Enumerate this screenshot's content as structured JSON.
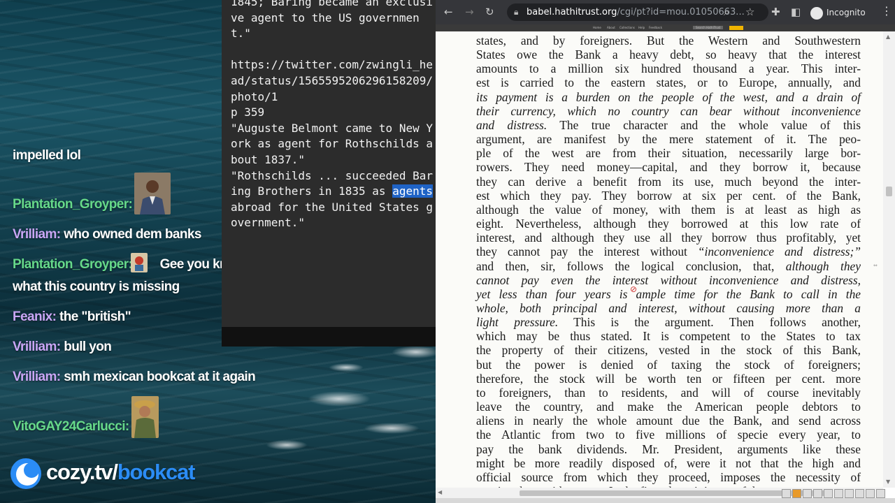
{
  "chat": {
    "messages": [
      {
        "user": "",
        "user_color": "#ffffff",
        "text": "impelled lol"
      },
      {
        "user": "Plantation_Groyper:",
        "user_color": "#66d98a",
        "text": "",
        "avatar": "man-in-suit-avatar"
      },
      {
        "user": "Vrilliam:",
        "user_color": "#c9a6f5",
        "text": "who owned dem banks"
      },
      {
        "user": "Plantation_Groyper:",
        "user_color": "#66d98a",
        "text": "Gee you know",
        "avatar": "cartoon-emote-avatar",
        "text2": "what this country is missing"
      },
      {
        "user": "Feanix:",
        "user_color": "#c9a6f5",
        "text": "the \"british\""
      },
      {
        "user": "Vrilliam:",
        "user_color": "#c9a6f5",
        "text": "bull yon"
      },
      {
        "user": "Vrilliam:",
        "user_color": "#c9a6f5",
        "text": "smh mexican bookcat at it again"
      },
      {
        "user": "VitoGAY24Carlucci:",
        "user_color": "#66d98a",
        "text": "",
        "avatar": "painted-portrait-avatar"
      }
    ]
  },
  "notes": {
    "line_top": "1845; Baring became an exclusive agent to the US government.\"",
    "blank": "",
    "link": "https://twitter.com/zwingli_head/status/1565595206296158209/photo/1",
    "page_ref": "p 359",
    "quote1": "\"Auguste Belmont came to New York as agent for Rothschilds about 1837.\"",
    "quote2_before": "\"Rothschilds ... succeeded Baring Brothers in 1835 as ",
    "quote2_highlight": "agents",
    "quote2_after": " abroad for the United States government.\""
  },
  "browser": {
    "url_host": "babel.hathitrust.org",
    "url_path": "/cgi/pt?id=mou.01050663...",
    "profile_label": "Incognito",
    "hathi_menu": [
      "Home",
      "About",
      "Collections",
      "Help",
      "Feedback"
    ],
    "hathi_search": "Search HathiTrust",
    "page_lines": [
      "states, and by foreigners. But the Western and Southwestern",
      "States owe the Bank a heavy debt, so heavy that the interest",
      "amounts to a million six hundred thousand a year. This inter-",
      "est is carried to the eastern states, or to Europe, annually, and",
      "its payment is a burden on the people of the west, and a drain of",
      "their currency, which no country can bear without inconvenience",
      "and distress. The true character and the whole value of this",
      "argument, are manifest by the mere statement of it. The peo-",
      "ple of the west are from their situation, necessarily large bor-",
      "rowers. They need money—capital, and they borrow it, because",
      "they can derive a benefit from its use, much beyond the inter-",
      "est which they pay. They borrow at six per cent. of the Bank,",
      "although the value of money, with them is at least as high as",
      "eight. Nevertheless, although they borrowed at this low rate of",
      "interest, and although they use all they borrow thus profitably, yet",
      "they cannot pay the interest without “inconvenience and distress;”",
      "and then, sir, follows the logical conclusion, that, although they",
      "cannot pay even the interest without inconvenience and distress,",
      "yet less than four years is ample time for the Bank to call in the",
      "whole, both principal and interest, without causing more than a",
      "light pressure. This is the argument. Then follows another,",
      "which may be thus stated. It is competent to the States to tax",
      "the property of their citizens, vested in the stock of this Bank,",
      "but the power is denied of taxing the stock of foreigners;",
      "therefore, the stock will be worth ten or fifteen per cent. more",
      "to foreigners, than to residents, and will of course inevitably",
      "leave the country, and make the American people debtors to",
      "aliens in nearly the whole amount due the Bank, and send across",
      "the Atlantic from two to five millions of specie every year, to",
      "pay the bank dividends. Mr. President, arguments like these",
      "might be more readily disposed of, were it not that the high and",
      "official source from which they proceed, imposes the necessity of",
      "treating them with respect. In the first place, it is one of the"
    ]
  },
  "logo": {
    "domain": "cozy.tv/",
    "channel": "bookcat"
  },
  "colors": {
    "accent_blue": "#2b8cf5",
    "highlight_blue": "#1f63c6",
    "chat_green": "#66d98a",
    "chat_purple": "#c9a6f5"
  }
}
